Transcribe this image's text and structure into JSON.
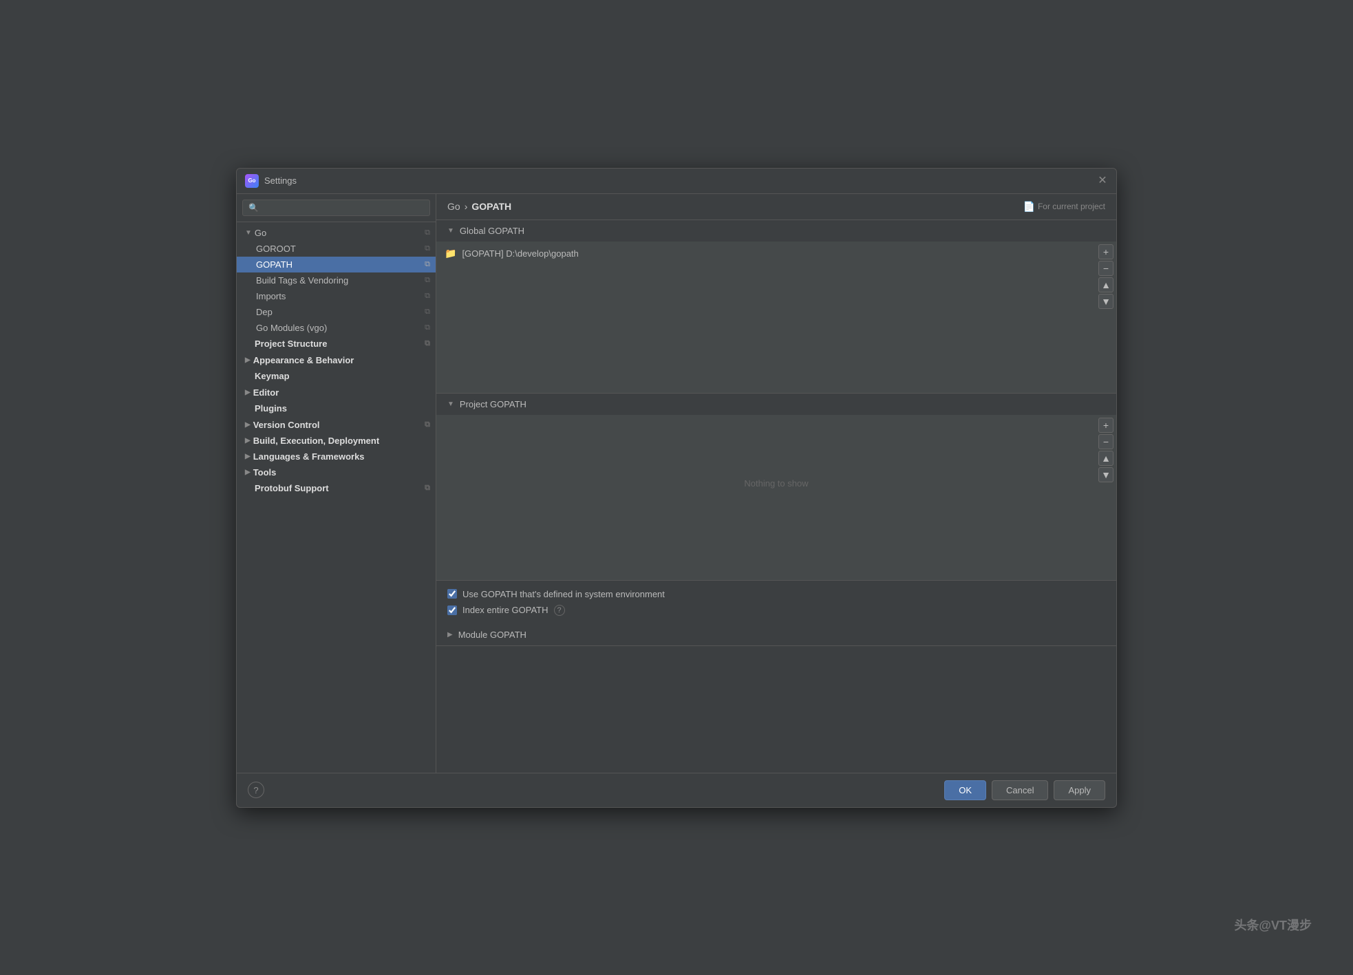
{
  "dialog": {
    "title": "Settings",
    "app_icon_text": "Go"
  },
  "search": {
    "placeholder": "🔍"
  },
  "sidebar": {
    "items": [
      {
        "id": "go",
        "label": "Go",
        "level": 0,
        "arrow": "▼",
        "has_copy": true,
        "bold": false
      },
      {
        "id": "goroot",
        "label": "GOROOT",
        "level": 1,
        "arrow": "",
        "has_copy": true,
        "bold": false
      },
      {
        "id": "gopath",
        "label": "GOPATH",
        "level": 1,
        "arrow": "",
        "has_copy": true,
        "bold": false,
        "selected": true
      },
      {
        "id": "build-tags",
        "label": "Build Tags & Vendoring",
        "level": 1,
        "arrow": "",
        "has_copy": true,
        "bold": false
      },
      {
        "id": "imports",
        "label": "Imports",
        "level": 1,
        "arrow": "",
        "has_copy": true,
        "bold": false
      },
      {
        "id": "dep",
        "label": "Dep",
        "level": 1,
        "arrow": "",
        "has_copy": true,
        "bold": false
      },
      {
        "id": "go-modules",
        "label": "Go Modules (vgo)",
        "level": 1,
        "arrow": "",
        "has_copy": true,
        "bold": false
      },
      {
        "id": "project-structure",
        "label": "Project Structure",
        "level": 0,
        "arrow": "",
        "has_copy": true,
        "bold": true
      },
      {
        "id": "appearance",
        "label": "Appearance & Behavior",
        "level": 0,
        "arrow": "▶",
        "has_copy": false,
        "bold": true
      },
      {
        "id": "keymap",
        "label": "Keymap",
        "level": 0,
        "arrow": "",
        "has_copy": false,
        "bold": true
      },
      {
        "id": "editor",
        "label": "Editor",
        "level": 0,
        "arrow": "▶",
        "has_copy": false,
        "bold": true
      },
      {
        "id": "plugins",
        "label": "Plugins",
        "level": 0,
        "arrow": "",
        "has_copy": false,
        "bold": true
      },
      {
        "id": "version-control",
        "label": "Version Control",
        "level": 0,
        "arrow": "▶",
        "has_copy": true,
        "bold": true
      },
      {
        "id": "build-exec-deploy",
        "label": "Build, Execution, Deployment",
        "level": 0,
        "arrow": "▶",
        "has_copy": false,
        "bold": true
      },
      {
        "id": "languages-frameworks",
        "label": "Languages & Frameworks",
        "level": 0,
        "arrow": "▶",
        "has_copy": false,
        "bold": true
      },
      {
        "id": "tools",
        "label": "Tools",
        "level": 0,
        "arrow": "▶",
        "has_copy": false,
        "bold": true
      },
      {
        "id": "protobuf",
        "label": "Protobuf Support",
        "level": 0,
        "arrow": "",
        "has_copy": true,
        "bold": true
      }
    ]
  },
  "header": {
    "breadcrumb_parent": "Go",
    "breadcrumb_sep": "›",
    "breadcrumb_current": "GOPATH",
    "for_current_label": "For current project"
  },
  "global_gopath": {
    "section_title": "Global GOPATH",
    "arrow": "▼",
    "path_item": "[GOPATH] D:\\develop\\gopath",
    "add_btn": "+",
    "remove_btn": "−",
    "up_btn": "▲",
    "down_btn": "▼"
  },
  "project_gopath": {
    "section_title": "Project GOPATH",
    "arrow": "▼",
    "empty_message": "Nothing to show",
    "add_btn": "+",
    "remove_btn": "−",
    "up_btn": "▲",
    "down_btn": "▼"
  },
  "checkboxes": {
    "use_gopath_label": "Use GOPATH that's defined in system environment",
    "index_gopath_label": "Index entire GOPATH",
    "use_gopath_checked": true,
    "index_gopath_checked": true
  },
  "module_gopath": {
    "section_title": "Module GOPATH",
    "arrow": "▶"
  },
  "footer": {
    "help_label": "?",
    "ok_label": "OK",
    "cancel_label": "Cancel",
    "apply_label": "Apply"
  },
  "watermark": "头条@VT漫步"
}
